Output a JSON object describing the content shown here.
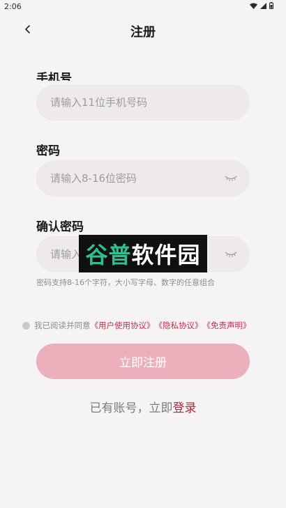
{
  "status_bar": {
    "time": "2:06",
    "icons": [
      "wifi-icon",
      "signal-icon",
      "battery-icon"
    ]
  },
  "header": {
    "title": "注册",
    "back_icon": "chevron-left-icon"
  },
  "form": {
    "phone": {
      "label": "手机号",
      "placeholder": "请输入11位手机号码",
      "value": ""
    },
    "password": {
      "label": "密码",
      "placeholder": "请输入8-16位密码",
      "value": "",
      "toggle_icon": "eye-closed-icon"
    },
    "confirm": {
      "label": "确认密码",
      "placeholder": "请输入8-16位密码",
      "value": "",
      "toggle_icon": "eye-closed-icon"
    },
    "hint": "密码支持8-16个字符，大小写字母、数字的任意组合"
  },
  "watermark": {
    "part1": "谷普",
    "part2": "软件园"
  },
  "agreement": {
    "prefix": "我已阅读并同意",
    "links": [
      "《用户使用协议》",
      "《隐私协议》",
      "《免责声明》"
    ],
    "checked": false
  },
  "submit_label": "立即注册",
  "login": {
    "prefix": "已有账号，立即",
    "link": "登录"
  },
  "colors": {
    "background": "#f5f3f3",
    "input_bg": "#eeeaea",
    "button_bg": "#ebb0bb",
    "link": "#c2314f",
    "login_link": "#b0253e"
  }
}
